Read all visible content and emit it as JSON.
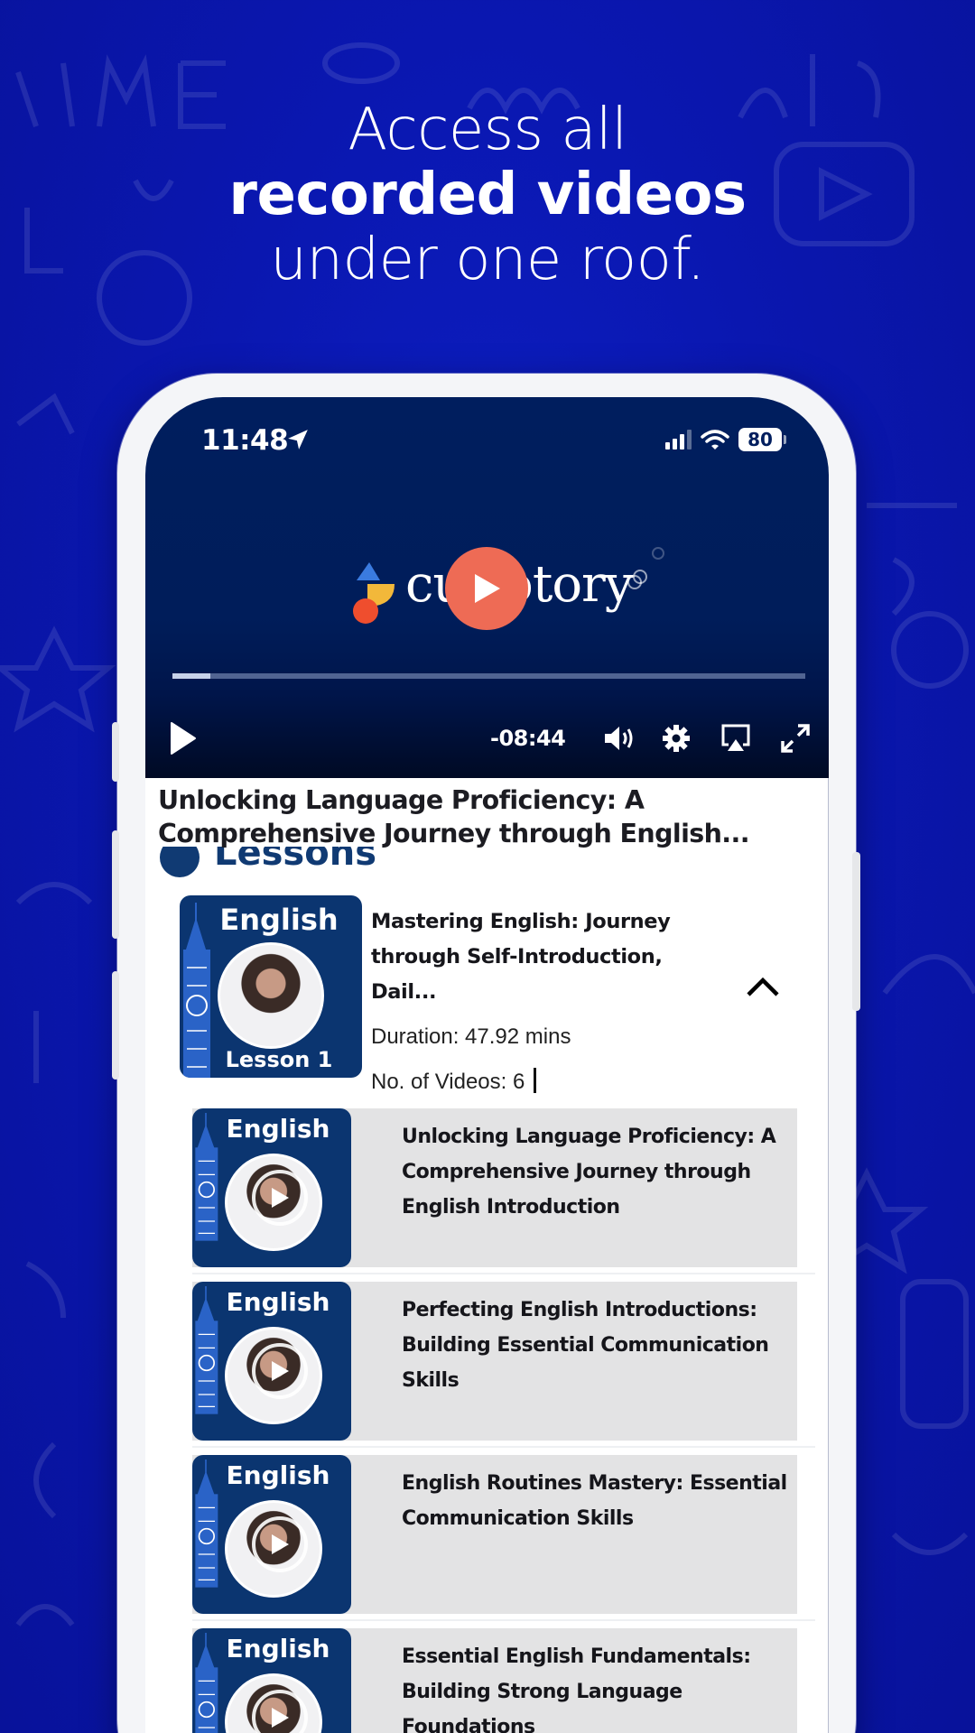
{
  "promo": {
    "line1": "Access all",
    "line2": "recorded videos",
    "line3": "under one roof."
  },
  "status_bar": {
    "time": "11:48",
    "battery": "80",
    "icons": [
      "location-arrow-icon",
      "cellular-signal-icon",
      "wifi-icon",
      "battery-icon"
    ]
  },
  "player": {
    "brand": "curiotory",
    "remaining_time": "-08:44",
    "progress_fraction": 0.06,
    "accent_color": "#ee6b55",
    "controls": [
      "play-icon",
      "volume-icon",
      "settings-gear-icon",
      "airplay-icon",
      "fullscreen-icon"
    ]
  },
  "video_title": "Unlocking Language Proficiency: A Comprehensive Journey through English...",
  "section_heading": "Lessons",
  "lesson": {
    "thumb_title": "English",
    "thumb_label": "Lesson 1",
    "title": "Mastering English: Journey through Self-Introduction, Dail...",
    "duration": "Duration: 47.92 mins",
    "video_count": "No. of Videos: 6"
  },
  "videos": [
    {
      "thumb_title": "English",
      "title": "Unlocking Language Proficiency: A Comprehensive Journey through English Introduction"
    },
    {
      "thumb_title": "English",
      "title": "Perfecting English Introductions: Building Essential Communication Skills"
    },
    {
      "thumb_title": "English",
      "title": "English Routines Mastery: Essential Communication Skills"
    },
    {
      "thumb_title": "English",
      "title": "Essential English Fundamentals: Building Strong Language Foundations"
    }
  ]
}
